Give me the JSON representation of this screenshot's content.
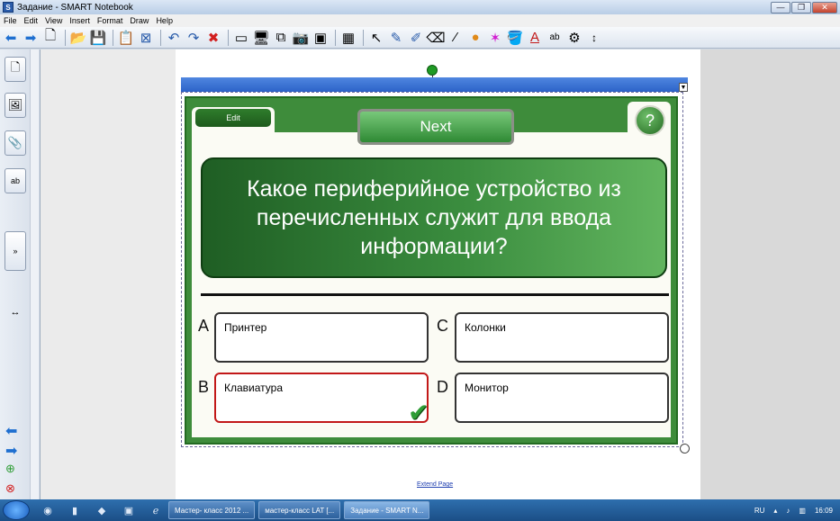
{
  "window": {
    "title": "Задание - SMART Notebook",
    "minimize": "—",
    "maximize": "❐",
    "close": "✕"
  },
  "menu": [
    "File",
    "Edit",
    "View",
    "Insert",
    "Format",
    "Draw",
    "Help"
  ],
  "toolbar": {
    "icons": [
      "back-icon",
      "forward-icon",
      "add-page-icon",
      "open-icon",
      "save-icon",
      "paste-icon",
      "delete-page-icon",
      "undo-icon",
      "redo-icon",
      "delete-icon",
      "screen-shade-icon",
      "full-screen-icon",
      "dual-display-icon",
      "capture-icon",
      "document-camera-icon",
      "table-icon",
      "select-icon",
      "pen-icon",
      "creative-pen-icon",
      "eraser-icon",
      "line-icon",
      "shape-icon",
      "magic-pen-icon",
      "fill-icon",
      "text-icon",
      "recognize-icon",
      "properties-icon",
      "move-toolbar-icon"
    ],
    "glyphs": [
      "⬅",
      "➡",
      "🗋",
      "📂",
      "💾",
      "📋",
      "⊠",
      "↶",
      "↷",
      "✖",
      "▭",
      "🖥",
      "⧉",
      "📷",
      "▣",
      "▦",
      "↖",
      "✎",
      "✐",
      "⌫",
      "⁄",
      "●",
      "✶",
      "🪣",
      "A",
      "ab",
      "⚙",
      "↕"
    ]
  },
  "quiz": {
    "edit_label": "Edit",
    "next_label": "Next",
    "help_label": "?",
    "question": "Какое периферийное устройство из перечисленных служит для ввода информации?",
    "answers": [
      {
        "letter": "A",
        "text": "Принтер"
      },
      {
        "letter": "C",
        "text": "Колонки"
      },
      {
        "letter": "B",
        "text": "Клавиатура",
        "correct": true
      },
      {
        "letter": "D",
        "text": "Монитор"
      }
    ],
    "check": "✔"
  },
  "extend_page": "Extend Page",
  "taskbar": {
    "tasks": [
      "Мастер- класс 2012 ...",
      "мастер-класс LAT [...",
      "Задание - SMART N..."
    ],
    "lang": "RU",
    "time": "16:09"
  },
  "colors": {
    "board": "#3e8c3b",
    "correct_border": "#c21818",
    "check": "#2f9d36"
  }
}
